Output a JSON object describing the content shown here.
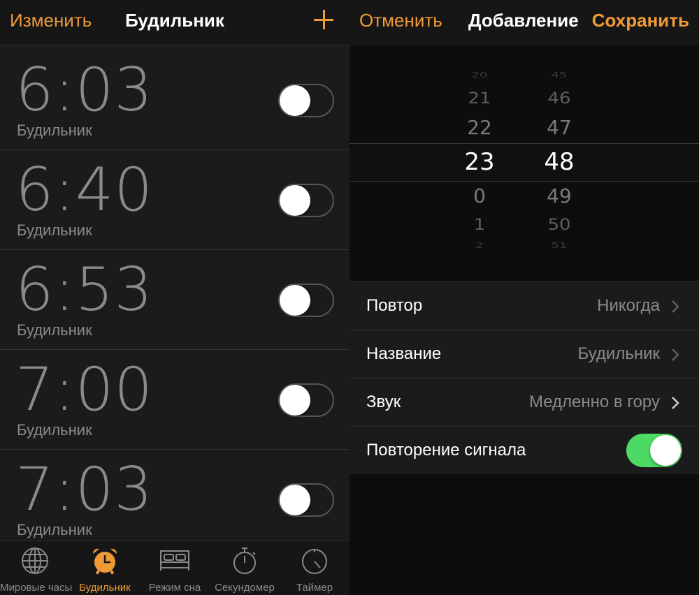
{
  "left": {
    "nav": {
      "edit": "Изменить",
      "title": "Будильник",
      "add_icon": "plus-icon"
    },
    "alarms": [
      {
        "time": "6:03",
        "label": "Будильник",
        "enabled": false
      },
      {
        "time": "6:40",
        "label": "Будильник",
        "enabled": false
      },
      {
        "time": "6:53",
        "label": "Будильник",
        "enabled": false
      },
      {
        "time": "7:00",
        "label": "Будильник",
        "enabled": false
      },
      {
        "time": "7:03",
        "label": "Будильник",
        "enabled": false
      }
    ],
    "tabs": [
      {
        "label": "Мировые часы",
        "icon": "globe-icon",
        "active": false
      },
      {
        "label": "Будильник",
        "icon": "alarm-clock-icon",
        "active": true
      },
      {
        "label": "Режим сна",
        "icon": "bed-icon",
        "active": false
      },
      {
        "label": "Секундомер",
        "icon": "stopwatch-icon",
        "active": false
      },
      {
        "label": "Таймер",
        "icon": "timer-icon",
        "active": false
      }
    ]
  },
  "right": {
    "nav": {
      "cancel": "Отменить",
      "title": "Добавление",
      "save": "Сохранить"
    },
    "picker": {
      "hours": [
        "20",
        "21",
        "22",
        "23",
        "0",
        "1",
        "2"
      ],
      "minutes": [
        "45",
        "46",
        "47",
        "48",
        "49",
        "50",
        "51"
      ],
      "selected_hour": "23",
      "selected_minute": "48"
    },
    "settings": {
      "repeat": {
        "label": "Повтор",
        "value": "Никогда"
      },
      "name": {
        "label": "Название",
        "value": "Будильник"
      },
      "sound": {
        "label": "Звук",
        "value": "Медленно в гору"
      },
      "snooze": {
        "label": "Повторение сигнала",
        "enabled": true
      }
    }
  },
  "colors": {
    "accent": "#f09a37",
    "toggle_on": "#4cd964",
    "muted_text": "#8a8a8a"
  }
}
